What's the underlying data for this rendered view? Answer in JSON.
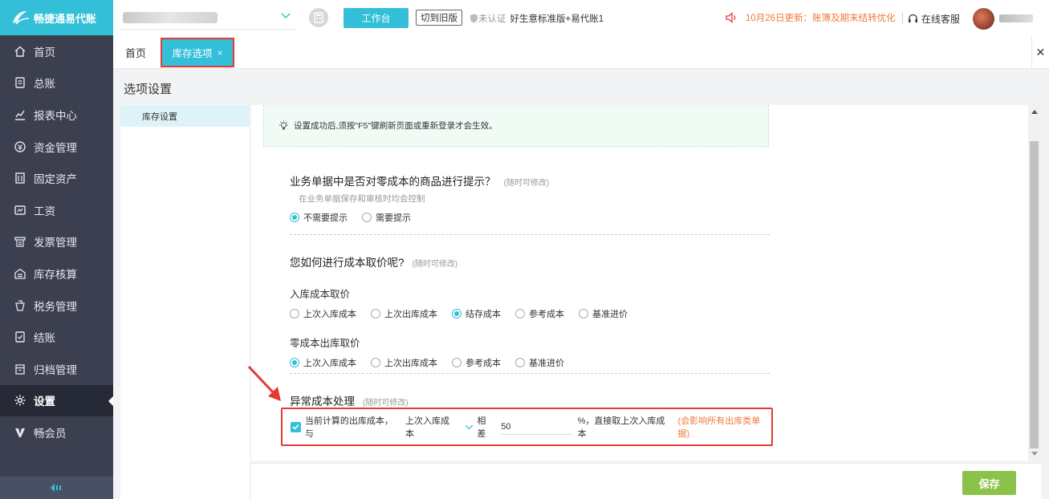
{
  "sidebar": {
    "logo": "畅捷通易代账",
    "items": [
      {
        "label": "首页",
        "icon": "home-icon"
      },
      {
        "label": "总账",
        "icon": "ledger-icon"
      },
      {
        "label": "报表中心",
        "icon": "chart-icon"
      },
      {
        "label": "资金管理",
        "icon": "fund-icon"
      },
      {
        "label": "固定资产",
        "icon": "building-icon"
      },
      {
        "label": "工资",
        "icon": "salary-icon"
      },
      {
        "label": "发票管理",
        "icon": "invoice-icon"
      },
      {
        "label": "库存核算",
        "icon": "warehouse-icon"
      },
      {
        "label": "税务管理",
        "icon": "tax-icon"
      },
      {
        "label": "结账",
        "icon": "checkout-icon"
      },
      {
        "label": "归档管理",
        "icon": "archive-icon"
      },
      {
        "label": "设置",
        "icon": "gear-icon"
      },
      {
        "label": "畅会员",
        "icon": "vip-icon"
      }
    ],
    "active_index": 11
  },
  "header": {
    "workbench_label": "工作台",
    "old_version_label": "切到旧版",
    "cert_status": "未认证",
    "product_name": "好生意标准版+易代账1",
    "notice": "10月26日更新：账簿及期末结转优化",
    "support_label": "在线客服"
  },
  "tabs": {
    "home": "首页",
    "active": "库存选项",
    "close_glyph": "×"
  },
  "page": {
    "title": "选项设置",
    "tree_item": "库存设置",
    "tip": "设置成功后,须按\"F5\"键刷新页面或重新登录才会生效。"
  },
  "q1": {
    "title": "业务单据中是否对零成本的商品进行提示？",
    "hint": "(随时可修改)",
    "sub": "在业务单据保存和审核时均会控制",
    "options": [
      "不需要提示",
      "需要提示"
    ],
    "selected": 0
  },
  "q2": {
    "title": "您如何进行成本取价呢?",
    "hint": "(随时可修改)",
    "inbound_label": "入库成本取价",
    "inbound_options": [
      "上次入库成本",
      "上次出库成本",
      "结存成本",
      "参考成本",
      "基准进价"
    ],
    "inbound_selected": 2,
    "zero_label": "零成本出库取价",
    "zero_options": [
      "上次入库成本",
      "上次出库成本",
      "参考成本",
      "基准进价"
    ],
    "zero_selected": 0
  },
  "q3": {
    "title": "异常成本处理",
    "hint": "(随时可修改)",
    "checked": true,
    "prefix": "当前计算的出库成本，与",
    "select_value": "上次入库成本",
    "diff_label": "相差",
    "diff_value": "50",
    "suffix": "%，直接取上次入库成本",
    "warning": "(会影响所有出库类单据)"
  },
  "footer": {
    "save_label": "保存"
  },
  "colors": {
    "accent": "#33bfd8",
    "sidebar_bg": "#3b3f50",
    "save_green": "#8bc34a",
    "warning_orange": "#ef7a3b",
    "highlight_red": "#e53935"
  }
}
